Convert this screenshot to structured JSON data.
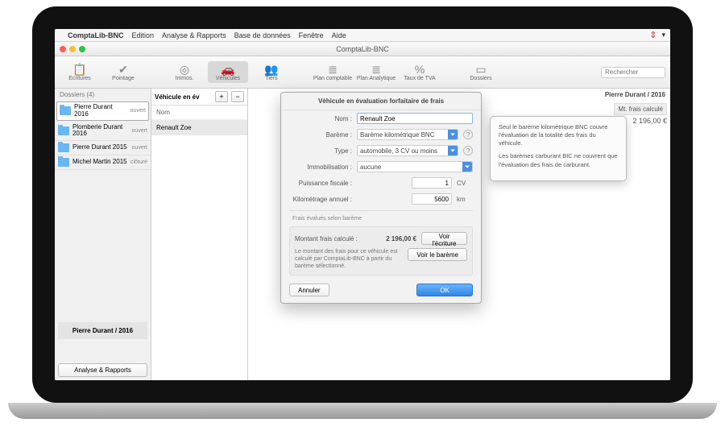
{
  "menubar": {
    "app": "ComptaLib-BNC",
    "items": [
      "Edition",
      "Analyse & Rapports",
      "Base de données",
      "Fenêtre",
      "Aide"
    ]
  },
  "window": {
    "title": "ComptaLib-BNC"
  },
  "toolbar": {
    "items": [
      {
        "label": "Ecritures",
        "icon": "📋"
      },
      {
        "label": "Pointage",
        "icon": "✔"
      },
      {
        "label": "Immos.",
        "icon": "◎"
      },
      {
        "label": "Véhicules",
        "icon": "🚗",
        "active": true
      },
      {
        "label": "Tiers",
        "icon": "👥"
      },
      {
        "label": "Plan comptable",
        "icon": "≣"
      },
      {
        "label": "Plan Analytique",
        "icon": "≣"
      },
      {
        "label": "Taux de TVA",
        "icon": "%"
      },
      {
        "label": "Dossiers",
        "icon": "▭"
      }
    ],
    "search_placeholder": "Rechercher"
  },
  "sidebar": {
    "header": "Dossiers (4)",
    "items": [
      {
        "name": "Pierre Durant 2016",
        "status": "ouvert",
        "selected": true
      },
      {
        "name": "Plomberie Durant 2016",
        "status": "ouvert"
      },
      {
        "name": "Pierre Durant 2015",
        "status": "ouvert"
      },
      {
        "name": "Michel Martin 2015",
        "status": "clôturé"
      }
    ],
    "current": "Pierre Durant / 2016",
    "analyse_btn": "Analyse & Rapports"
  },
  "midlist": {
    "title": "Véhicule en év",
    "col": "Nom",
    "rows": [
      "Renault Zoe"
    ]
  },
  "main": {
    "context": "Pierre Durant / 2016",
    "col_header": "Mt. frais calculé",
    "amount": "2 196,00 €"
  },
  "dialog": {
    "title": "Véhicule en évaluation forfaitaire de frais",
    "labels": {
      "nom": "Nom :",
      "bareme": "Barème :",
      "type": "Type :",
      "immo": "Immobilisation :",
      "puissance": "Puissance fiscale :",
      "km": "Kilométrage annuel :"
    },
    "values": {
      "nom": "Renault Zoe",
      "bareme": "Barème kilométrique BNC",
      "type": "automobile, 3 CV ou moins",
      "immo": "aucune",
      "puissance": "1",
      "puissance_unit": "CV",
      "km": "5600",
      "km_unit": "km"
    },
    "subhead": "Frais évalués selon barème",
    "result": {
      "label": "Montant frais calculé :",
      "amount": "2 196,00 €",
      "voir_ecriture": "Voir l'écriture",
      "note": "Le montant des frais pour ce véhicule est calculé par ComptaLib-BNC à partir du barème sélectionné.",
      "voir_bareme": "Voir le barème"
    },
    "cancel": "Annuler",
    "ok": "OK"
  },
  "popover": {
    "p1": "Seul le barème kilométrique BNC couvre l'évaluation de la totalité des frais du véhicule.",
    "p2": "Les barèmes carburant BIC ne couvrent que l'évaluation des frais de carburant."
  }
}
